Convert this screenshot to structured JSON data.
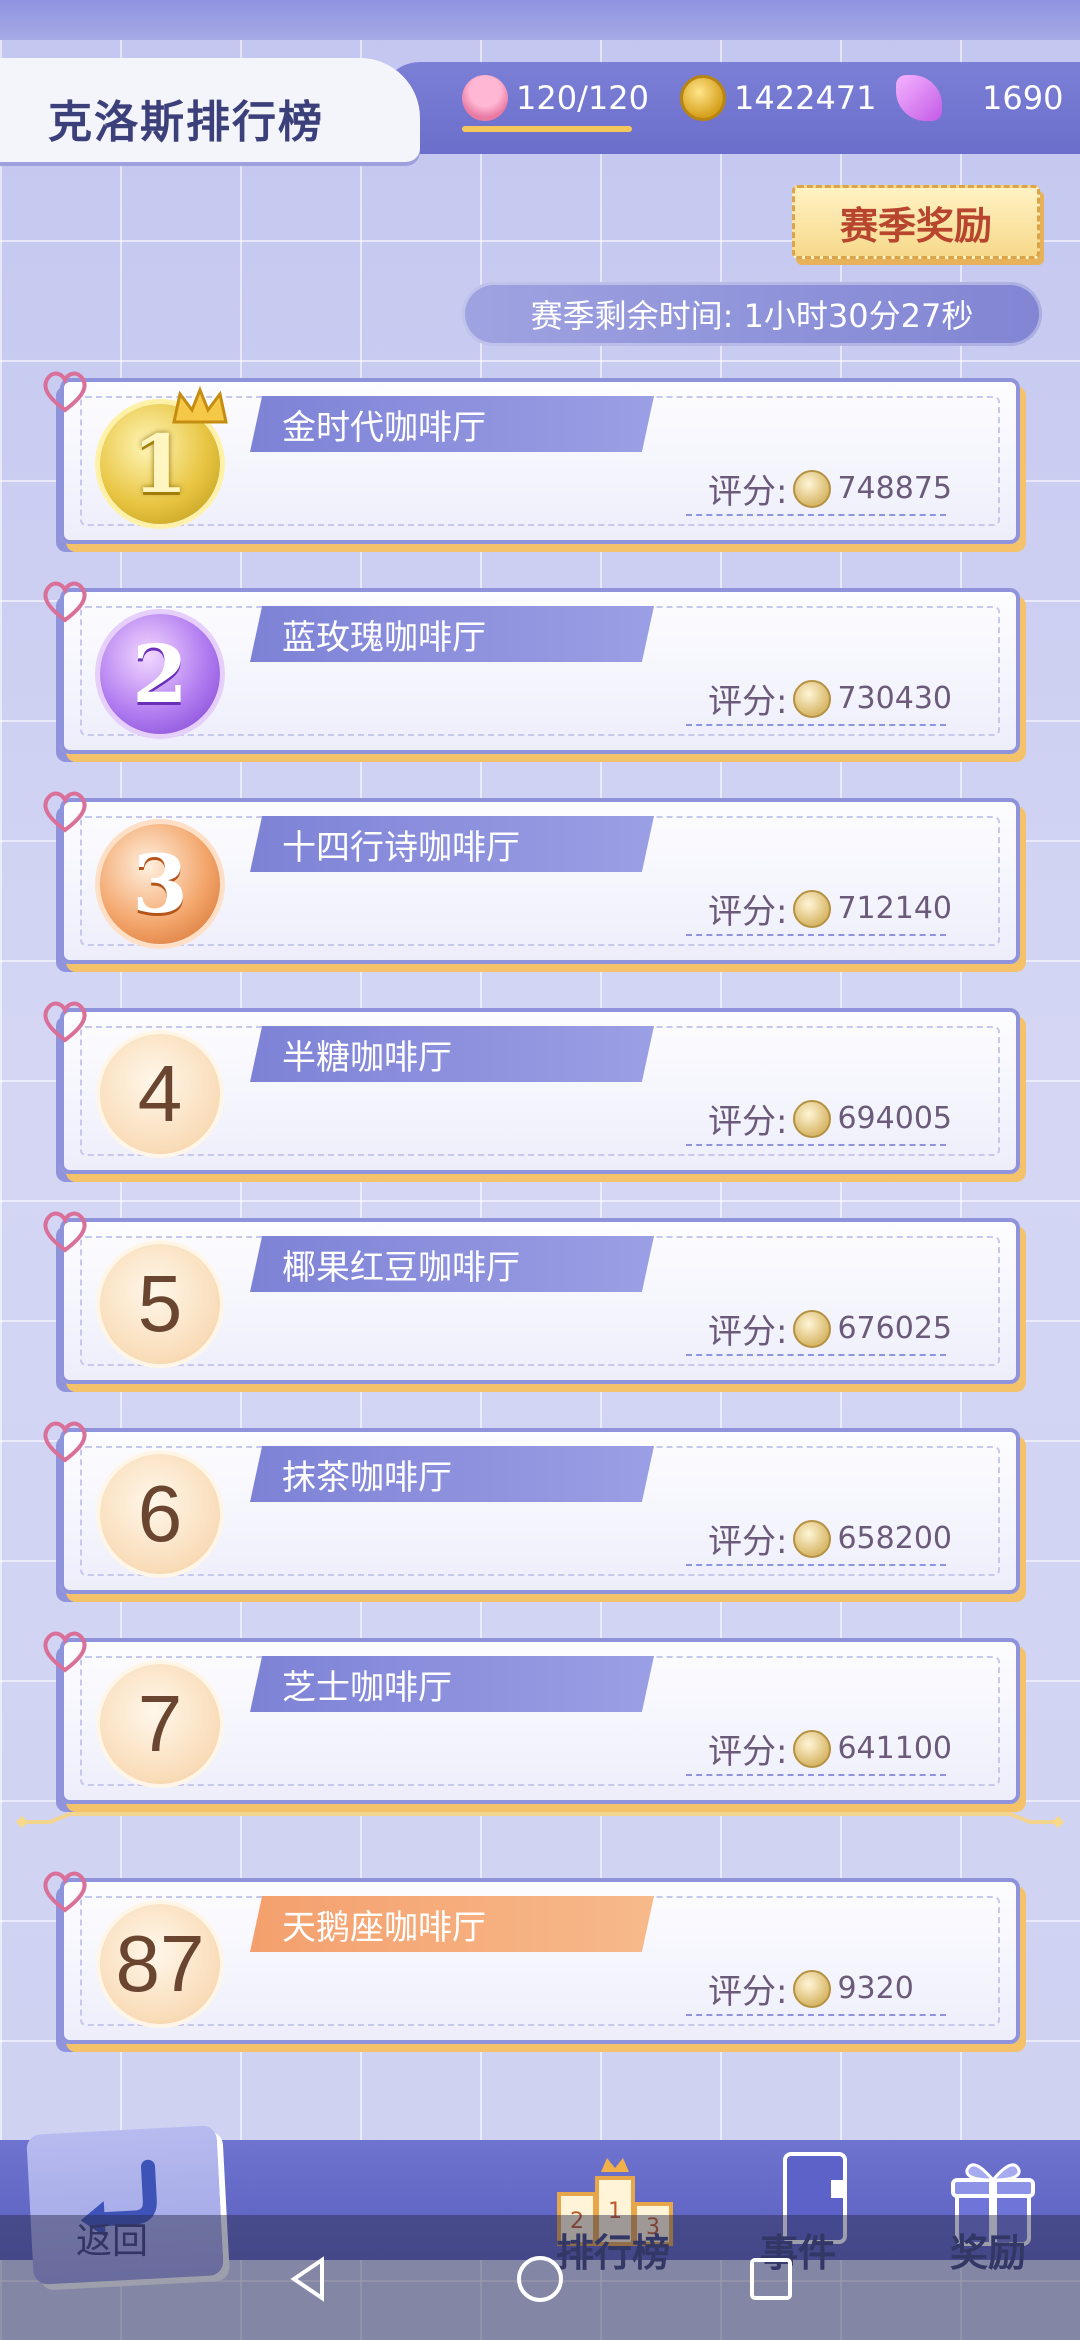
{
  "header": {
    "title": "克洛斯排行榜",
    "resources": [
      {
        "icon": "cake-icon",
        "value": "120/120"
      },
      {
        "icon": "gold-coin-icon",
        "value": "1422471"
      },
      {
        "icon": "gem-icon",
        "value": "1690"
      }
    ]
  },
  "season": {
    "reward_button": "赛季奖励",
    "timer_label": "赛季剩余时间: 1小时30分27秒"
  },
  "score_label": "评分:",
  "rankings": [
    {
      "rank": "1",
      "name": "金时代咖啡厅",
      "score": "748875"
    },
    {
      "rank": "2",
      "name": "蓝玫瑰咖啡厅",
      "score": "730430"
    },
    {
      "rank": "3",
      "name": "十四行诗咖啡厅",
      "score": "712140"
    },
    {
      "rank": "4",
      "name": "半糖咖啡厅",
      "score": "694005"
    },
    {
      "rank": "5",
      "name": "椰果红豆咖啡厅",
      "score": "676025"
    },
    {
      "rank": "6",
      "name": "抹茶咖啡厅",
      "score": "658200"
    },
    {
      "rank": "7",
      "name": "芝士咖啡厅",
      "score": "641100"
    }
  ],
  "self_entry": {
    "rank": "87",
    "name": "天鹅座咖啡厅",
    "score": "9320"
  },
  "bottom_nav": {
    "back": "返回",
    "leaderboard": "排行榜",
    "podium_digits": [
      "2",
      "1",
      "3"
    ],
    "events": "事件",
    "rewards": "奖励"
  },
  "colors": {
    "accent": "#7b7fd6",
    "self_highlight": "#f4a06d",
    "gold": "#e8c542"
  }
}
